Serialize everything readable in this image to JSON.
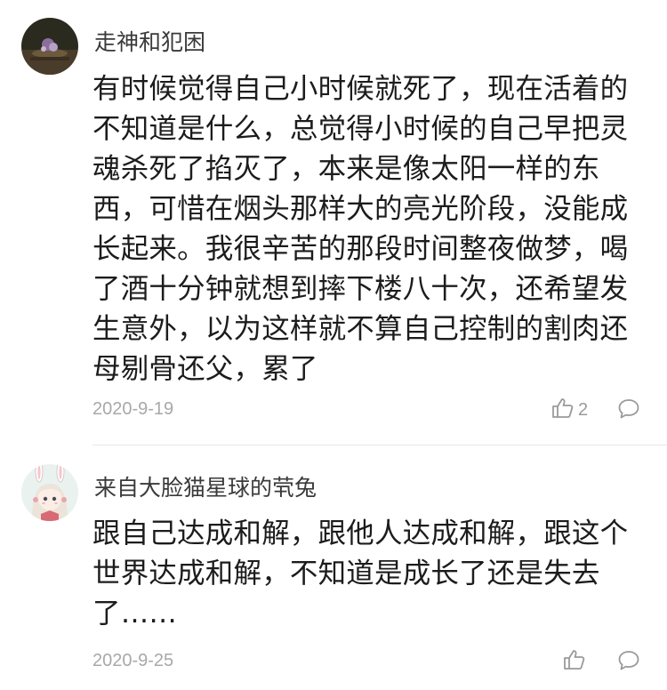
{
  "comments": [
    {
      "username": "走神和犯困",
      "lines": [
        "有时候觉得自己小时候就死了，现在活着的",
        "不知道是什么，总觉得小时候的自己早把灵",
        "魂杀死了掐灭了，本来是像太阳一样的东",
        "西，可惜在烟头那样大的亮光阶段，没能成",
        "长起来。我很辛苦的那段时间整夜做梦，喝",
        "了酒十分钟就想到摔下楼八十次，还希望发",
        "生意外，以为这样就不算自己控制的割肉还",
        "母剔骨还父，累了"
      ],
      "date": "2020-9-19",
      "like_count": "2",
      "like_icon": "thumbs-up-icon",
      "reply_icon": "comment-bubble-icon"
    },
    {
      "username": "来自大脸猫星球的茕兔",
      "lines": [
        "跟自己达成和解，跟他人达成和解，跟这个",
        "世界达成和解，不知道是成长了还是失去",
        "了……"
      ],
      "date": "2020-9-25",
      "like_count": "",
      "like_icon": "thumbs-up-icon",
      "reply_icon": "comment-bubble-icon"
    }
  ],
  "colors": {
    "text": "#1c1c1c",
    "username": "#3a3a3a",
    "meta": "#a8a8a8",
    "icon": "#9a9a9a",
    "divider": "#e6e6e6"
  }
}
